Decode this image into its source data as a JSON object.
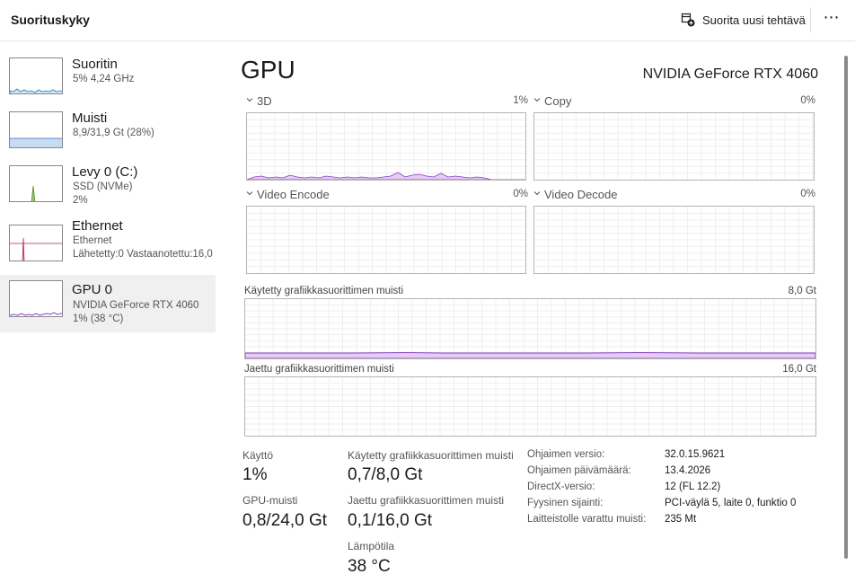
{
  "header": {
    "title": "Suorituskyky",
    "run_task_label": "Suorita uusi tehtävä",
    "more_label": "⋯"
  },
  "sidebar": {
    "items": [
      {
        "name": "Suoritin",
        "line1": "5%  4,24 GHz",
        "line2": "",
        "icon": "cpu-graph"
      },
      {
        "name": "Muisti",
        "line1": "8,9/31,9 Gt (28%)",
        "line2": "",
        "icon": "memory-graph"
      },
      {
        "name": "Levy 0 (C:)",
        "line1": "SSD (NVMe)",
        "line2": "2%",
        "icon": "disk-graph"
      },
      {
        "name": "Ethernet",
        "line1": "Ethernet",
        "line2": "Lähetetty:0  Vastaanotettu:16,0",
        "icon": "network-graph"
      },
      {
        "name": "GPU 0",
        "line1": "NVIDIA GeForce RTX 4060",
        "line2": "1%  (38 °C)",
        "icon": "gpu-graph"
      }
    ]
  },
  "main": {
    "title": "GPU",
    "gpu_name": "NVIDIA GeForce RTX 4060",
    "engines": [
      {
        "label": "3D",
        "percent": "1%"
      },
      {
        "label": "Copy",
        "percent": "0%"
      },
      {
        "label": "Video Encode",
        "percent": "0%"
      },
      {
        "label": "Video Decode",
        "percent": "0%"
      }
    ],
    "dedicated_memory": {
      "label": "Käytetty grafiikkasuorittimen muisti",
      "max": "8,0 Gt"
    },
    "shared_memory": {
      "label": "Jaettu grafiikkasuorittimen muisti",
      "max": "16,0 Gt"
    }
  },
  "stats": {
    "utilization_label": "Käyttö",
    "utilization_value": "1%",
    "gpu_memory_label": "GPU-muisti",
    "gpu_memory_value": "0,8/24,0 Gt",
    "dedicated_label": "Käytetty grafiikkasuorittimen muisti",
    "dedicated_value": "0,7/8,0 Gt",
    "shared_label": "Jaettu grafiikkasuorittimen muisti",
    "shared_value": "0,1/16,0 Gt",
    "temperature_label": "Lämpötila",
    "temperature_value": "38 °C"
  },
  "info": [
    {
      "label": "Ohjaimen versio:",
      "value": "32.0.15.9621"
    },
    {
      "label": "Ohjaimen päivämäärä:",
      "value": "13.4.2026"
    },
    {
      "label": "DirectX-versio:",
      "value": "12 (FL 12.2)"
    },
    {
      "label": "Fyysinen sijainti:",
      "value": "PCI-väylä 5, laite 0, funktio 0"
    },
    {
      "label": "Laitteistolle varattu muisti:",
      "value": "235 Mt"
    }
  ],
  "colors": {
    "cpu": "#1a7fc1",
    "memory": "#5a8fd0",
    "disk": "#4d8a1f",
    "network": "#b5225a",
    "gpu": "#8a3fc7"
  }
}
